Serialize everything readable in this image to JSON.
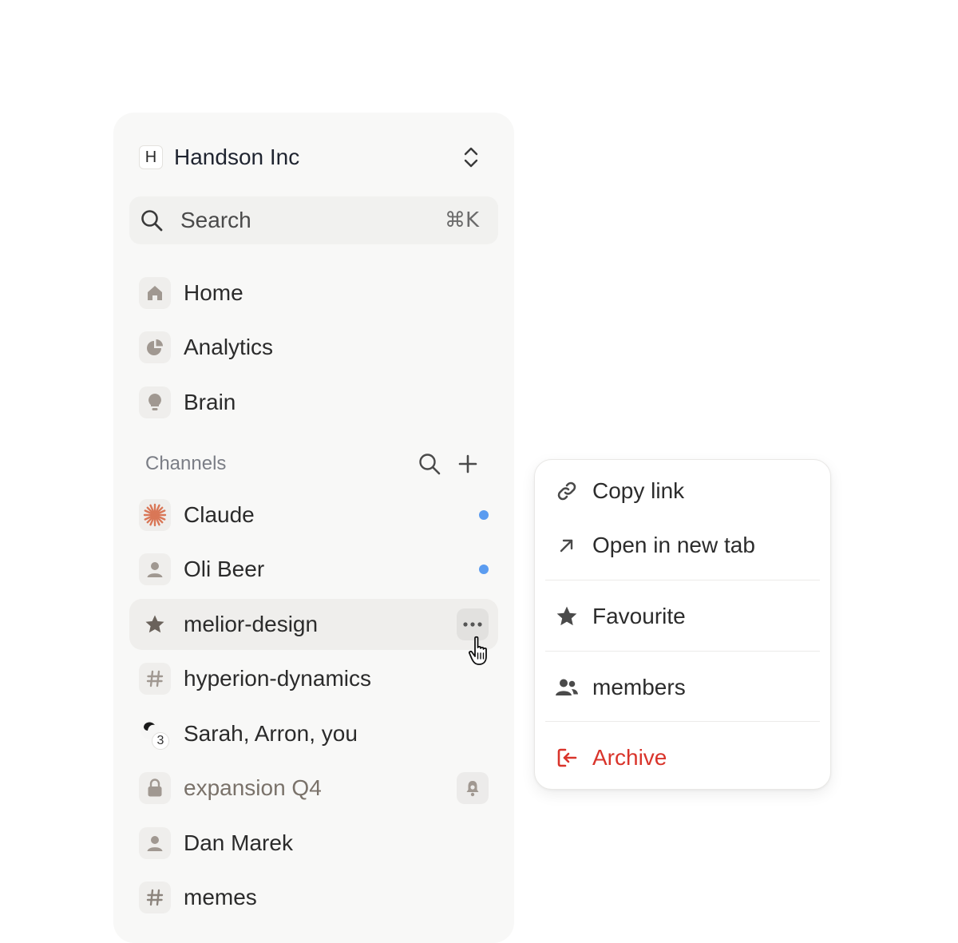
{
  "workspace": {
    "badge": "H",
    "name": "Handson Inc"
  },
  "search": {
    "label": "Search",
    "shortcut": "⌘K"
  },
  "nav": [
    {
      "label": "Home",
      "icon": "home-icon"
    },
    {
      "label": "Analytics",
      "icon": "pie-chart-icon"
    },
    {
      "label": "Brain",
      "icon": "lightbulb-icon"
    }
  ],
  "channels": {
    "title": "Channels",
    "items": [
      {
        "label": "Claude",
        "icon": "claude-sparkle-icon",
        "unread": true
      },
      {
        "label": "Oli Beer",
        "icon": "person-icon",
        "unread": true
      },
      {
        "label": "melior-design",
        "icon": "star-icon",
        "active": true
      },
      {
        "label": "hyperion-dynamics",
        "icon": "hash-icon"
      },
      {
        "label": "Sarah, Arron, you",
        "icon": "group-avatar",
        "count": "3"
      },
      {
        "label": "expansion Q4",
        "icon": "lock-icon",
        "muted": true
      },
      {
        "label": "Dan Marek",
        "icon": "person-icon"
      },
      {
        "label": "memes",
        "icon": "hash-icon"
      }
    ]
  },
  "menu": {
    "items": [
      {
        "label": "Copy link",
        "icon": "link-icon"
      },
      {
        "label": "Open in new tab",
        "icon": "arrow-up-right-icon"
      },
      {
        "label": "Favourite",
        "icon": "star-icon"
      },
      {
        "label": "members",
        "icon": "members-icon"
      },
      {
        "label": "Archive",
        "icon": "archive-exit-icon",
        "danger": true
      }
    ]
  },
  "colors": {
    "unread_dot": "#5b9cf0",
    "danger": "#d9342b",
    "claude_accent": "#d97757",
    "sidebar_bg": "#f8f8f7"
  }
}
